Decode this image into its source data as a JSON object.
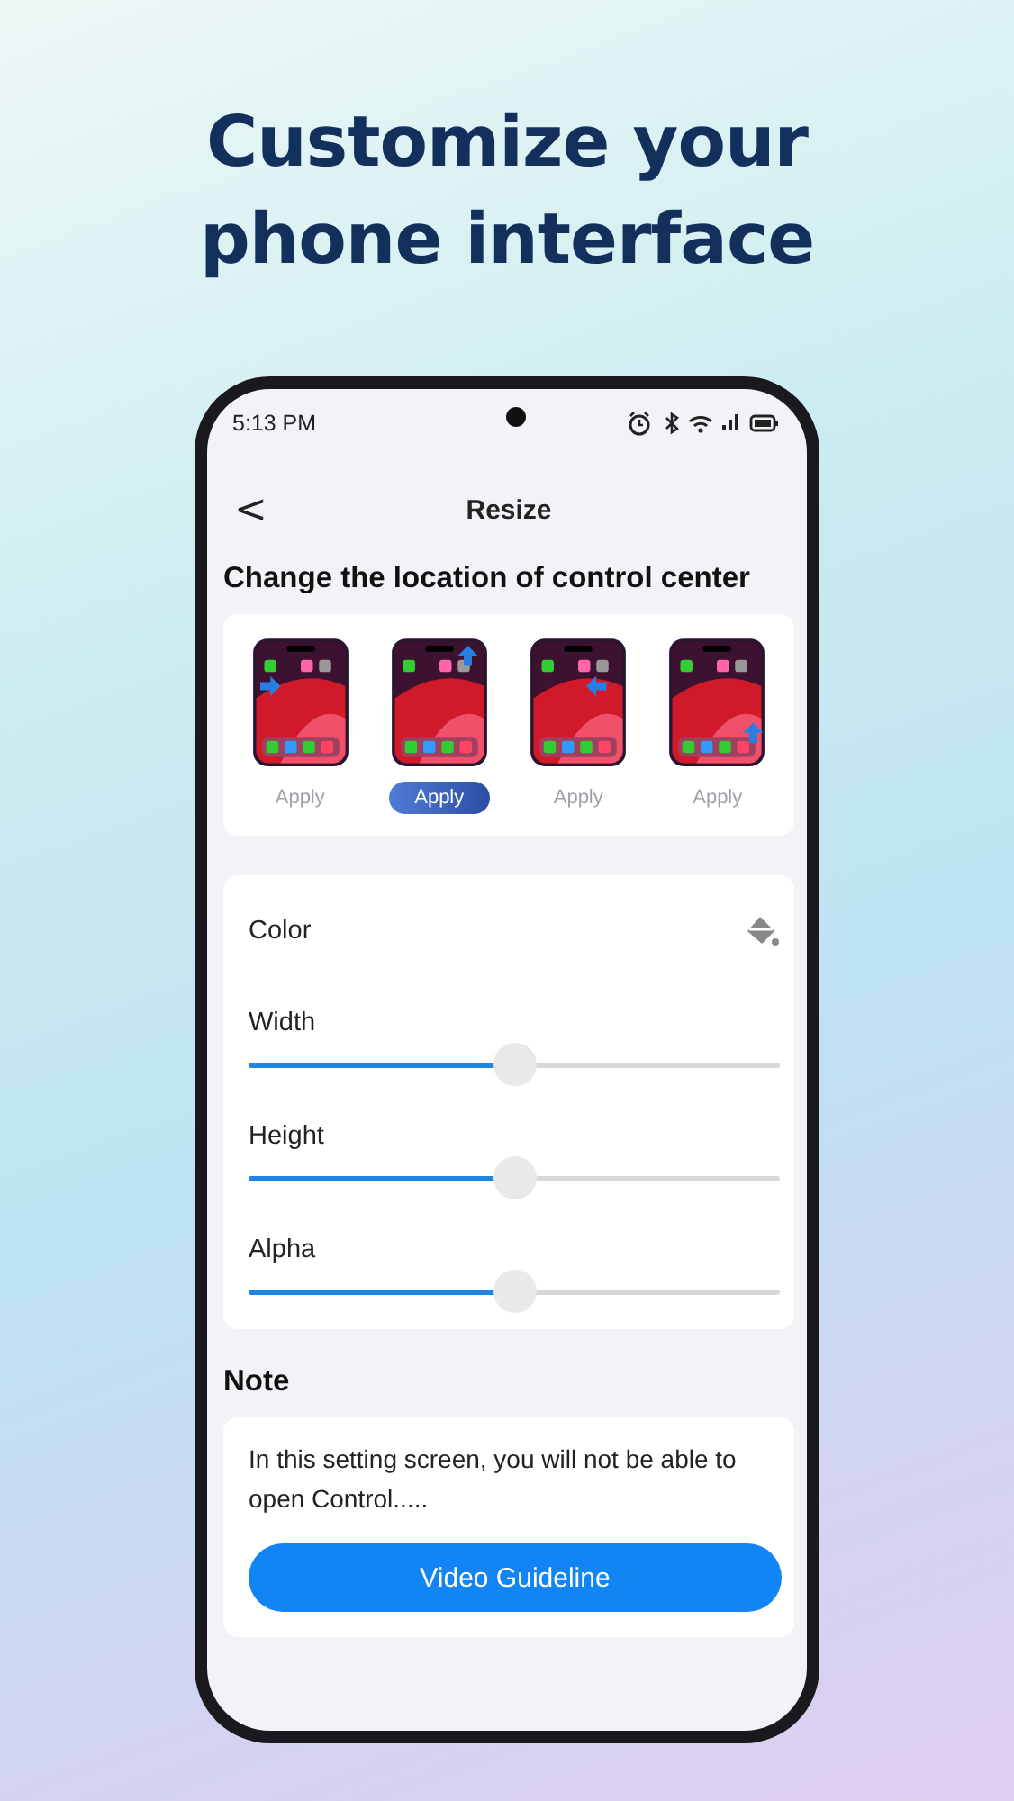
{
  "headline": "Customize your phone interface",
  "status_bar": {
    "time": "5:13 PM"
  },
  "header": {
    "back": "<",
    "title": "Resize"
  },
  "location_section": {
    "title": "Change the location of control center",
    "options": [
      {
        "kind": "left",
        "label": "Apply",
        "selected": false
      },
      {
        "kind": "top",
        "label": "Apply",
        "selected": true
      },
      {
        "kind": "right",
        "label": "Apply",
        "selected": false
      },
      {
        "kind": "bottom",
        "label": "Apply",
        "selected": false
      }
    ]
  },
  "settings": [
    {
      "kind": "color",
      "label": "Color"
    },
    {
      "kind": "slider",
      "label": "Width",
      "level": 0.5
    },
    {
      "kind": "slider",
      "label": "Height",
      "level": 0.5
    },
    {
      "kind": "slider",
      "label": "Alpha",
      "level": 0.5
    }
  ],
  "note": {
    "title": "Note",
    "text": "In this setting screen, you will not be able to open Control.....",
    "button": "Video Guideline"
  }
}
